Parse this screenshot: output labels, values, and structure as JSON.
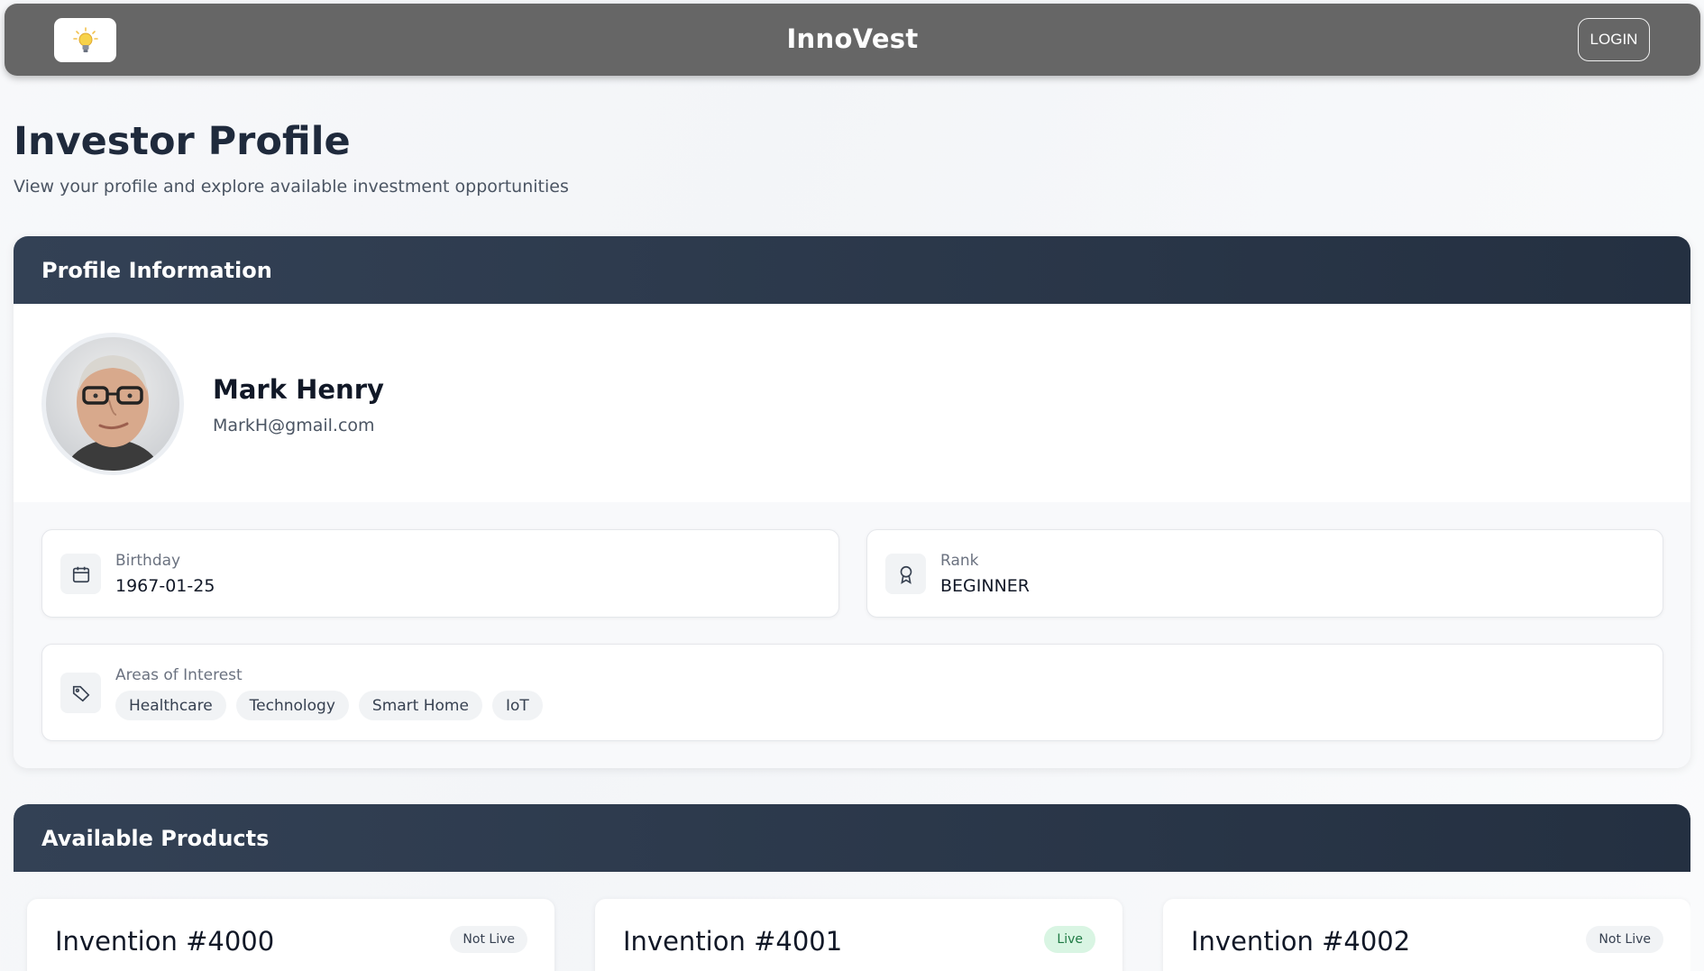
{
  "app": {
    "name": "InnoVest",
    "login_label": "LOGIN",
    "logo_icon": "lightbulb-icon"
  },
  "page": {
    "title": "Investor Profile",
    "subtitle": "View your profile and explore available investment opportunities"
  },
  "profile": {
    "section_title": "Profile Information",
    "name": "Mark Henry",
    "email": "MarkH@gmail.com",
    "birthday": {
      "label": "Birthday",
      "value": "1967-01-25",
      "icon": "calendar-icon"
    },
    "rank": {
      "label": "Rank",
      "value": "BEGINNER",
      "icon": "award-icon"
    },
    "interests": {
      "label": "Areas of Interest",
      "icon": "tag-icon",
      "items": [
        "Healthcare",
        "Technology",
        "Smart Home",
        "IoT"
      ]
    }
  },
  "products": {
    "section_title": "Available Products",
    "items": [
      {
        "title": "Invention #4000",
        "status": "Not Live"
      },
      {
        "title": "Invention #4001",
        "status": "Live"
      },
      {
        "title": "Invention #4002",
        "status": "Not Live"
      }
    ]
  },
  "colors": {
    "header_bg": "#666666",
    "section_header": "#2d3a4e",
    "live_badge": "#d9f5e3"
  }
}
